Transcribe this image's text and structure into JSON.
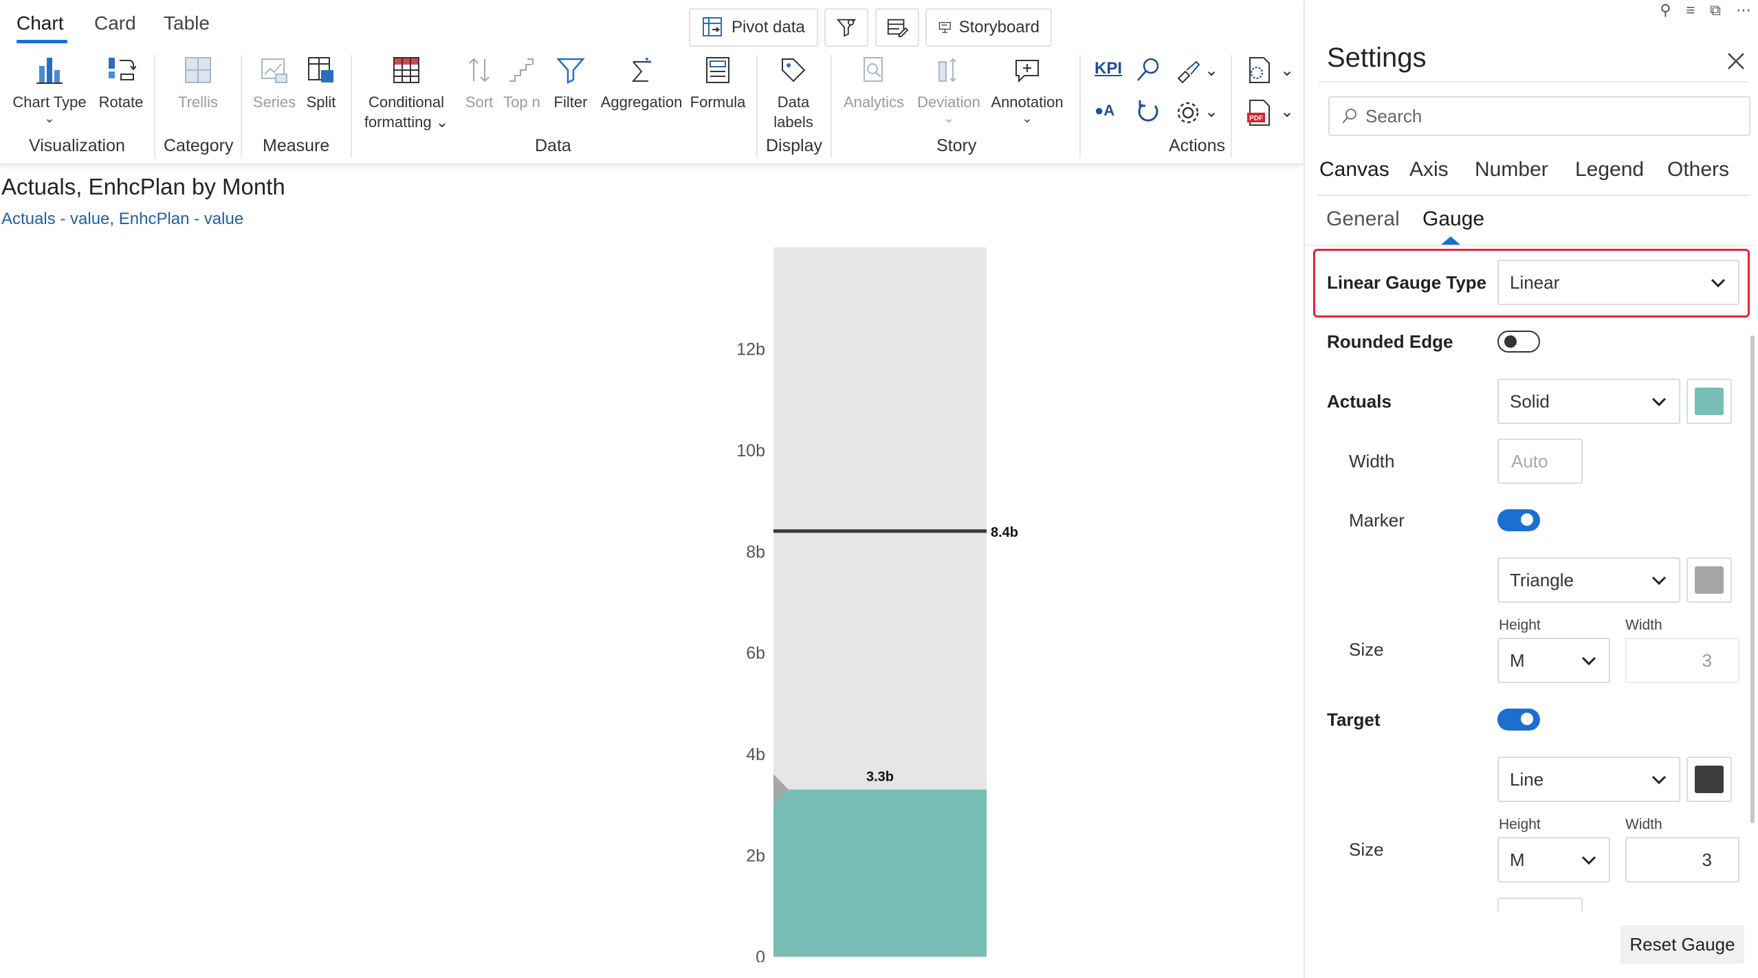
{
  "ribbon": {
    "top_tabs": [
      "Chart",
      "Card",
      "Table"
    ],
    "header_buttons": {
      "pivot": "Pivot data",
      "storyboard": "Storyboard"
    },
    "buttons": {
      "chart_type": "Chart Type",
      "rotate": "Rotate",
      "trellis": "Trellis",
      "series": "Series",
      "split": "Split",
      "conditional_line1": "Conditional",
      "conditional_line2": "formatting",
      "sort": "Sort",
      "topn": "Top n",
      "filter": "Filter",
      "aggregation": "Aggregation",
      "formula": "Formula",
      "data_labels_line1": "Data",
      "data_labels_line2": "labels",
      "analytics": "Analytics",
      "deviation": "Deviation",
      "annotation": "Annotation",
      "kpi": "KPI",
      "oa": "A"
    },
    "groups": {
      "visualization": "Visualization",
      "category": "Category",
      "measure": "Measure",
      "data": "Data",
      "display": "Display",
      "story": "Story",
      "actions": "Actions"
    }
  },
  "chart": {
    "title": "Actuals, EnhcPlan by Month",
    "subtitle": "Actuals - value, EnhcPlan - value"
  },
  "chart_data": {
    "type": "bar",
    "subtype": "linear-gauge",
    "ylim": [
      0,
      14
    ],
    "ytick_values": [
      0,
      2,
      4,
      6,
      8,
      10,
      12
    ],
    "ytick_labels": [
      "0",
      "2b",
      "4b",
      "6b",
      "8b",
      "10b",
      "12b"
    ],
    "series": [
      {
        "name": "Actuals",
        "value": 3.3,
        "label": "3.3b",
        "color": "#77bfb5"
      },
      {
        "name": "EnhcPlan",
        "value": 8.4,
        "label": "8.4b",
        "color": "#3a3a3a"
      }
    ],
    "track_color": "#e6e6e6",
    "marker_color": "#a6a6a6"
  },
  "settings": {
    "title": "Settings",
    "search_placeholder": "Search",
    "tabs": [
      "Canvas",
      "Axis",
      "Number",
      "Legend",
      "Others"
    ],
    "subtabs": [
      "General",
      "Gauge"
    ],
    "linear_gauge_type": {
      "label": "Linear Gauge Type",
      "value": "Linear"
    },
    "rounded_edge": {
      "label": "Rounded Edge",
      "on": false
    },
    "actuals": {
      "label": "Actuals",
      "style": "Solid",
      "color": "#77bfb5"
    },
    "width": {
      "label": "Width",
      "placeholder": "Auto"
    },
    "marker": {
      "label": "Marker",
      "on": true,
      "shape": "Triangle",
      "color": "#a6a6a6"
    },
    "marker_size": {
      "label": "Size",
      "height_label": "Height",
      "width_label": "Width",
      "height": "M",
      "width": "3"
    },
    "target": {
      "label": "Target",
      "on": true,
      "style": "Line",
      "color": "#3d3d3d"
    },
    "target_size": {
      "label": "Size",
      "height_label": "Height",
      "width_label": "Width",
      "height": "M",
      "width": "3"
    },
    "reset": "Reset Gauge"
  }
}
